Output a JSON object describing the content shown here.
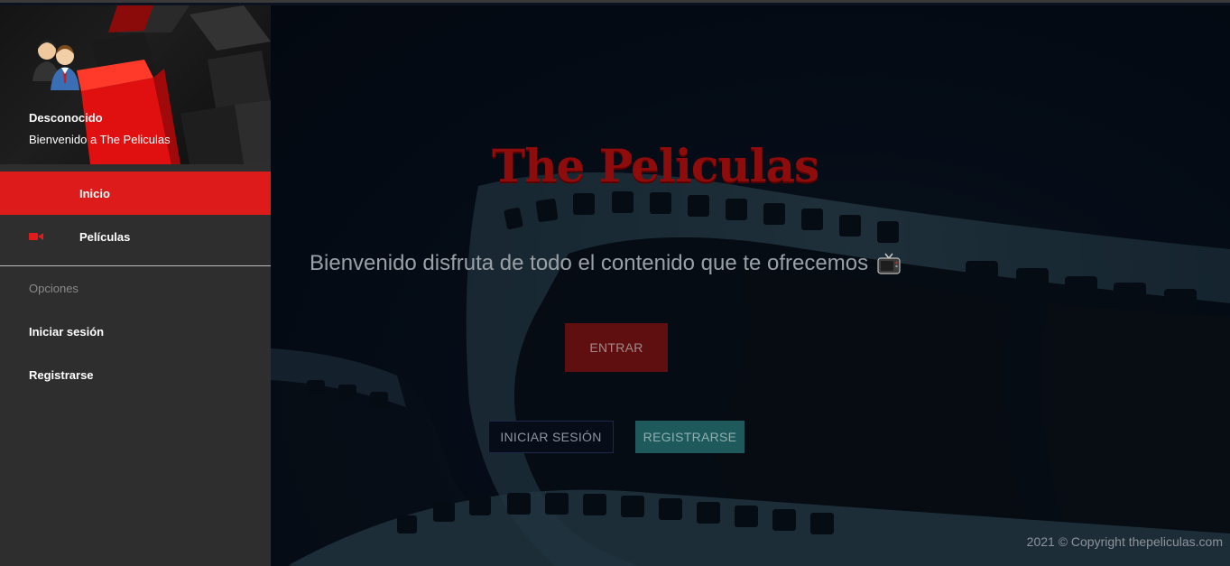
{
  "sidebar": {
    "profile": {
      "name": "Desconocido",
      "subtitle": "Bienvenido a The Peliculas"
    },
    "nav": [
      {
        "label": "Inicio",
        "icon": "home-icon",
        "active": true
      },
      {
        "label": "Películas",
        "icon": "video-camera-icon",
        "active": false
      }
    ],
    "section_title": "Opciones",
    "options": [
      {
        "label": "Iniciar sesión"
      },
      {
        "label": "Registrarse"
      }
    ]
  },
  "main": {
    "logo_text": "The Peliculas",
    "welcome_text": "Bienvenido disfruta de todo el contenido que te ofrecemos",
    "welcome_icon": "tv-icon",
    "buttons": {
      "enter": "ENTRAR",
      "login": "INICIAR SESIÓN",
      "register": "REGISTRARSE"
    },
    "footer": "2021 © Copyright thepeliculas.com"
  },
  "colors": {
    "accent_red": "#dd1b1b",
    "sidebar_bg": "#2e2e2e",
    "logo_red": "#8e0c0c",
    "register_teal": "#1e5a5c"
  }
}
